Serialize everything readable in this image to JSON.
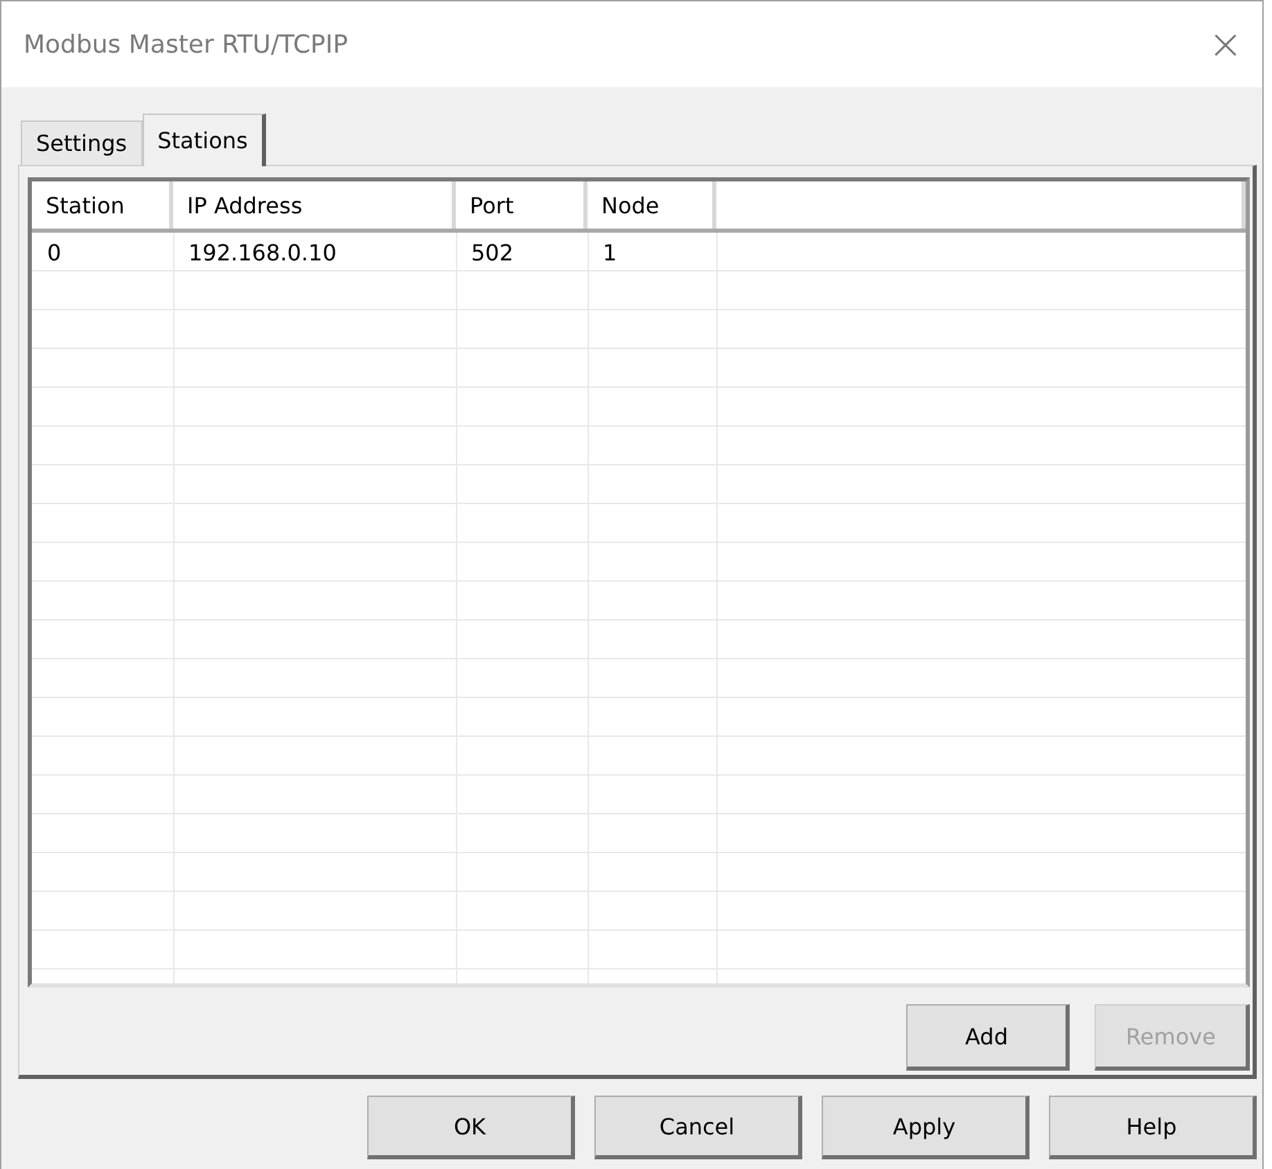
{
  "window": {
    "title": "Modbus Master RTU/TCPIP",
    "close": "×"
  },
  "tabs": [
    {
      "label": "Settings",
      "selected": false
    },
    {
      "label": "Stations",
      "selected": true
    }
  ],
  "table": {
    "columns": [
      "Station",
      "IP Address",
      "Port",
      "Node"
    ],
    "rows": [
      [
        "0",
        "192.168.0.10",
        "502",
        "1"
      ]
    ]
  },
  "panel_buttons": [
    {
      "label": "Add",
      "disabled": false
    },
    {
      "label": "Remove",
      "disabled": true
    }
  ],
  "dialog_buttons": [
    {
      "label": "OK",
      "disabled": false
    },
    {
      "label": "Cancel",
      "disabled": false
    },
    {
      "label": "Apply",
      "disabled": false
    },
    {
      "label": "Help",
      "disabled": false
    }
  ]
}
